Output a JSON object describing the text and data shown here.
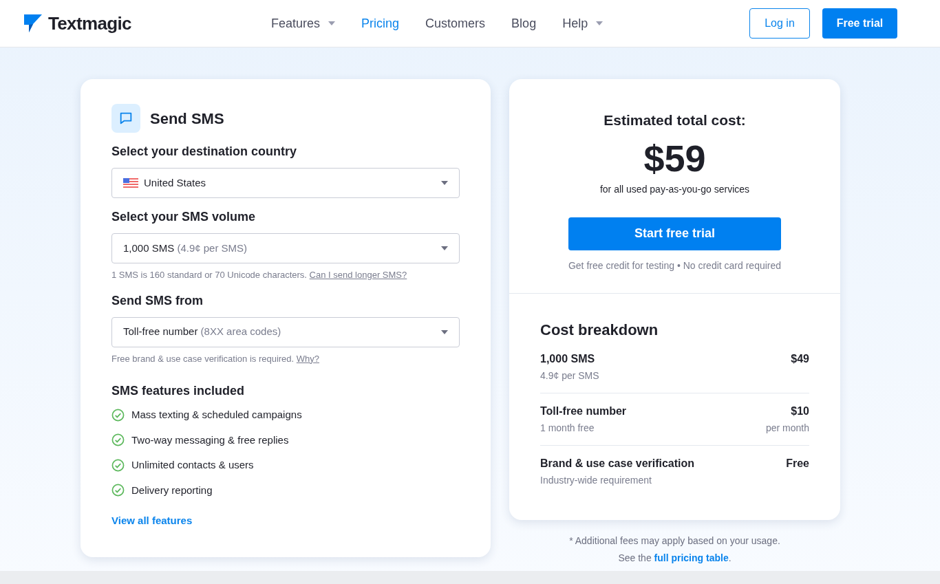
{
  "header": {
    "logo": "Textmagic",
    "nav": [
      {
        "label": "Features",
        "has_menu": true,
        "selected": false
      },
      {
        "label": "Pricing",
        "has_menu": false,
        "selected": true
      },
      {
        "label": "Customers",
        "has_menu": false,
        "selected": false
      },
      {
        "label": "Blog",
        "has_menu": false,
        "selected": false
      },
      {
        "label": "Help",
        "has_menu": true,
        "selected": false
      }
    ],
    "login": "Log in",
    "trial": "Free trial"
  },
  "calculator": {
    "title": "Send SMS",
    "fields": [
      {
        "label": "Select your destination country",
        "value": "United States",
        "flag": true
      },
      {
        "label": "Select your SMS volume",
        "value": "1,000 SMS",
        "detail": "(4.9¢ per SMS)",
        "note": "1 SMS is 160 standard or 70 Unicode characters.",
        "note_link": "Can I send longer SMS?"
      },
      {
        "label": "Send SMS from",
        "value": "Toll-free number",
        "detail": "(8XX area codes)",
        "note": "Free brand & use case verification is required.",
        "note_link": "Why?"
      }
    ],
    "features_title": "SMS features included",
    "features": [
      "Mass texting & scheduled campaigns",
      "Two-way messaging & free replies",
      "Unlimited contacts & users",
      "Delivery reporting"
    ],
    "features_link": "View all features"
  },
  "estimate": {
    "title": "Estimated total cost:",
    "total": "$59",
    "subtitle": "for all used pay-as-you-go services",
    "button": "Start free trial",
    "hint": "Get free credit for testing • No credit card required",
    "breakdown_title": "Cost breakdown",
    "rows": [
      {
        "name": "1,000 SMS",
        "sub": "4.9¢ per SMS",
        "price": "$49"
      },
      {
        "name": "Toll-free number",
        "sub": "1 month free",
        "price": "$10",
        "price_sub": "per month"
      },
      {
        "name": "Brand & use case verification",
        "sub": "Industry-wide requirement",
        "price": "Free"
      }
    ]
  },
  "footnote": {
    "line1": "* Additional fees may apply based on your usage.",
    "before": "See the",
    "link": "full pricing table",
    "after": "."
  }
}
